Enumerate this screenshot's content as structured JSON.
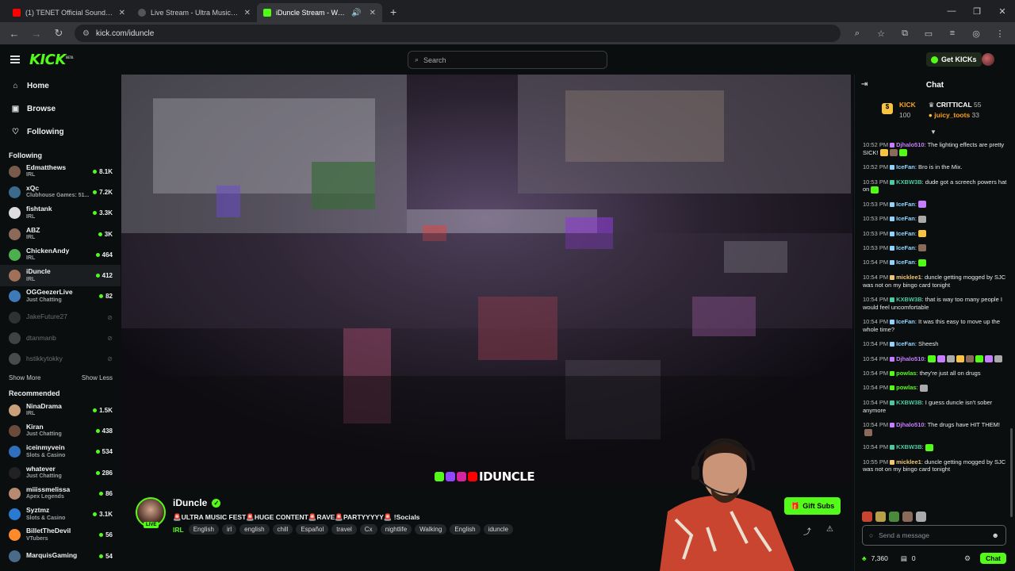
{
  "browser": {
    "tabs": [
      {
        "title": "(1) TENET Official Soundtrack |",
        "favicon_color": "#ff0000",
        "active": false
      },
      {
        "title": "Live Stream - Ultra Music Festi",
        "favicon_color": "#cccccc",
        "active": false
      },
      {
        "title": "iDuncle Stream - Watch Live",
        "favicon_color": "#53fc18",
        "active": true
      }
    ],
    "url": "kick.com/iduncle"
  },
  "header": {
    "logo": "KICK",
    "logo_badge": "BETA",
    "search_placeholder": "Search",
    "get_kicks_label": "Get KICKs"
  },
  "sidebar": {
    "nav": [
      {
        "label": "Home",
        "icon": "home-icon"
      },
      {
        "label": "Browse",
        "icon": "browse-icon"
      },
      {
        "label": "Following",
        "icon": "heart-icon"
      }
    ],
    "following_heading": "Following",
    "following": [
      {
        "name": "Edmatthews",
        "category": "IRL",
        "viewers": "8.1K",
        "color": "#7a5a4a"
      },
      {
        "name": "xQc",
        "category": "Clubhouse Games: 51...",
        "viewers": "7.2K",
        "color": "#3b6a8c"
      },
      {
        "name": "fishtank",
        "category": "IRL",
        "viewers": "3.3K",
        "color": "#ddd"
      },
      {
        "name": "ABZ",
        "category": "IRL",
        "viewers": "3K",
        "color": "#8c6a5a"
      },
      {
        "name": "ChickenAndy",
        "category": "IRL",
        "viewers": "464",
        "color": "#4caf50"
      },
      {
        "name": "iDuncle",
        "category": "IRL",
        "viewers": "412",
        "color": "#a0705a"
      },
      {
        "name": "OGGeezerLive",
        "category": "Just Chatting",
        "viewers": "82",
        "color": "#3f7ab8"
      }
    ],
    "offline": [
      {
        "name": "JakeFuture27",
        "color": "#555"
      },
      {
        "name": "dtanmanb",
        "color": "#777"
      },
      {
        "name": "hstikkytokky",
        "color": "#888"
      }
    ],
    "show_more": "Show More",
    "show_less": "Show Less",
    "recommended_heading": "Recommended",
    "recommended": [
      {
        "name": "NinaDrama",
        "category": "IRL",
        "viewers": "1.5K",
        "color": "#c9a07a"
      },
      {
        "name": "Kiran",
        "category": "Just Chatting",
        "viewers": "438",
        "color": "#6a4a3a"
      },
      {
        "name": "iceinmyvein",
        "category": "Slots & Casino",
        "viewers": "534",
        "color": "#2f6fbd"
      },
      {
        "name": "whatever",
        "category": "Just Chatting",
        "viewers": "286",
        "color": "#222"
      },
      {
        "name": "miiissmelissa",
        "category": "Apex Legends",
        "viewers": "86",
        "color": "#b88a70"
      },
      {
        "name": "Syztmz",
        "category": "Slots & Casino",
        "viewers": "3.1K",
        "color": "#2a7bd0"
      },
      {
        "name": "BilletTheDevil",
        "category": "VTubers",
        "viewers": "56",
        "color": "#ff8a2a"
      },
      {
        "name": "MarquisGaming",
        "category": "",
        "viewers": "54",
        "color": "#4a6a8a"
      }
    ]
  },
  "stream": {
    "watermark": "IDUNCLE",
    "streamer_name": "iDuncle",
    "live_badge": "LIVE",
    "title": "🚨ULTRA MUSIC FEST🚨HUGE CONTENT🚨RAVE🚨PARTYYYYY🚨 !Socials",
    "category": "IRL",
    "tags": [
      "English",
      "irl",
      "english",
      "chill",
      "Español",
      "travel",
      "Cx",
      "nightlife",
      "Walking",
      "English",
      "iduncle"
    ],
    "gift_subs_label": "Gift Subs"
  },
  "chat": {
    "title": "Chat",
    "leaderboard": [
      {
        "name": "KICK",
        "count": "100",
        "badge": "gold"
      },
      {
        "name": "CRITTICAL",
        "count": "55"
      },
      {
        "name": "juicy_toots",
        "count": "33"
      }
    ],
    "messages": [
      {
        "time": "10:52 PM",
        "user": "Djhalo510",
        "color": "#c77dff",
        "text": ": The lighting effects are pretty SICK!",
        "emotes": 3
      },
      {
        "time": "10:52 PM",
        "user": "IceFan",
        "color": "#8fd4ff",
        "text": ": Bro is in the Mix.",
        "emotes": 0
      },
      {
        "time": "10:53 PM",
        "user": "KXBW3B",
        "color": "#4cc9a0",
        "text": ": dude got a screech powers hat on",
        "emotes": 1
      },
      {
        "time": "10:53 PM",
        "user": "IceFan",
        "color": "#8fd4ff",
        "text": ":",
        "emotes": 1
      },
      {
        "time": "10:53 PM",
        "user": "IceFan",
        "color": "#8fd4ff",
        "text": ":",
        "emotes": 1
      },
      {
        "time": "10:53 PM",
        "user": "IceFan",
        "color": "#8fd4ff",
        "text": ":",
        "emotes": 1
      },
      {
        "time": "10:53 PM",
        "user": "IceFan",
        "color": "#8fd4ff",
        "text": ":",
        "emotes": 1
      },
      {
        "time": "10:54 PM",
        "user": "IceFan",
        "color": "#8fd4ff",
        "text": ":",
        "emotes": 1
      },
      {
        "time": "10:54 PM",
        "user": "micklee1",
        "color": "#f0c674",
        "text": ": duncle getting mogged by SJC was not on my bingo card tonight",
        "emotes": 0
      },
      {
        "time": "10:54 PM",
        "user": "KXBW3B",
        "color": "#4cc9a0",
        "text": ": that is way too many people I would feel uncomfortable",
        "emotes": 0
      },
      {
        "time": "10:54 PM",
        "user": "IceFan",
        "color": "#8fd4ff",
        "text": ": It was this easy to move up the whole time?",
        "emotes": 0
      },
      {
        "time": "10:54 PM",
        "user": "IceFan",
        "color": "#8fd4ff",
        "text": ": Sheesh",
        "emotes": 0
      },
      {
        "time": "10:54 PM",
        "user": "Djhalo510",
        "color": "#c77dff",
        "text": ":",
        "emotes": 8
      },
      {
        "time": "10:54 PM",
        "user": "powlas",
        "color": "#53fc18",
        "text": ": they're just all on drugs",
        "emotes": 0
      },
      {
        "time": "10:54 PM",
        "user": "powlas",
        "color": "#53fc18",
        "text": ":",
        "emotes": 1
      },
      {
        "time": "10:54 PM",
        "user": "KXBW3B",
        "color": "#4cc9a0",
        "text": ": I guess duncle isn't sober anymore",
        "emotes": 0
      },
      {
        "time": "10:54 PM",
        "user": "Djhalo510",
        "color": "#c77dff",
        "text": ": The drugs have HIT THEM!",
        "emotes": 1
      },
      {
        "time": "10:54 PM",
        "user": "KXBW3B",
        "color": "#4cc9a0",
        "text": ":",
        "emotes": 1
      },
      {
        "time": "10:55 PM",
        "user": "micklee1",
        "color": "#f0c674",
        "text": ": duncle getting mogged by SJC was not on my bingo card tonight",
        "emotes": 0
      }
    ],
    "input_placeholder": "Send a message",
    "kicks_balance": "7,360",
    "subs_count": "0",
    "chat_button": "Chat"
  }
}
